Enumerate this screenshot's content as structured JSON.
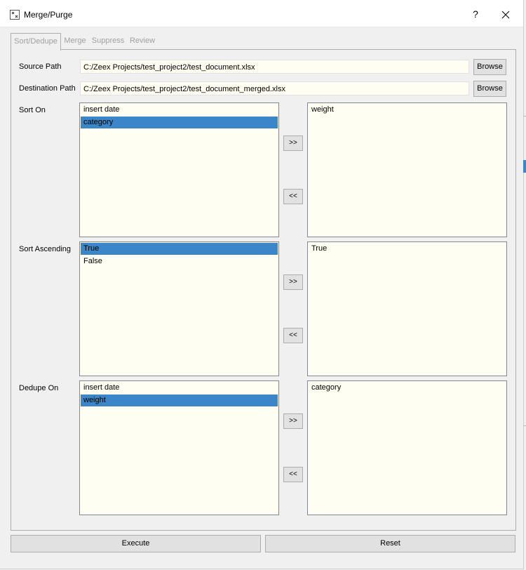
{
  "window": {
    "title": "Merge/Purge",
    "help_label": "?"
  },
  "tabs": [
    {
      "label": "Sort/Dedupe",
      "active": true
    },
    {
      "label": "Merge",
      "active": false
    },
    {
      "label": "Suppress",
      "active": false
    },
    {
      "label": "Review",
      "active": false
    }
  ],
  "paths": {
    "source_label": "Source Path",
    "source_value": "C:/Zeex Projects/test_project2/test_document.xlsx",
    "dest_label": "Destination Path",
    "dest_value": "C:/Zeex Projects/test_project2/test_document_merged.xlsx",
    "browse_label": "Browse"
  },
  "sections": [
    {
      "label": "Sort On",
      "left": [
        {
          "text": "insert date",
          "selected": false
        },
        {
          "text": "category",
          "selected": true
        }
      ],
      "right": [
        "weight"
      ]
    },
    {
      "label": "Sort Ascending",
      "left": [
        {
          "text": "True",
          "selected": true
        },
        {
          "text": "False",
          "selected": false
        }
      ],
      "right": [
        "True"
      ]
    },
    {
      "label": "Dedupe On",
      "left": [
        {
          "text": "insert date",
          "selected": false
        },
        {
          "text": "weight",
          "selected": true
        }
      ],
      "right": [
        "category"
      ]
    }
  ],
  "arrows": {
    "add": ">>",
    "remove": "<<"
  },
  "footer": {
    "execute_label": "Execute",
    "reset_label": "Reset"
  },
  "colors": {
    "selection": "#3a86c8",
    "field_bg": "#fffef2"
  }
}
